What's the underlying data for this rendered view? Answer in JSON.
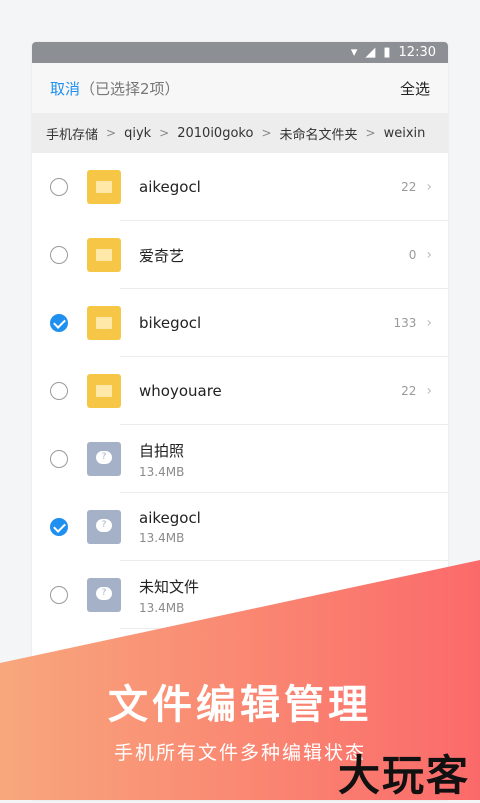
{
  "status": {
    "time": "12:30"
  },
  "toolbar": {
    "cancel": "取消",
    "selection_info": "（已选择2项）",
    "select_all": "全选"
  },
  "breadcrumb": [
    "手机存储",
    "qiyk",
    "2010i0goko",
    "未命名文件夹",
    "weixin"
  ],
  "items": [
    {
      "name": "aikegocl",
      "type": "folder",
      "count": "22",
      "checked": false
    },
    {
      "name": "爱奇艺",
      "type": "folder",
      "count": "0",
      "checked": false
    },
    {
      "name": "bikegocl",
      "type": "folder",
      "count": "133",
      "checked": true
    },
    {
      "name": "whoyouare",
      "type": "folder",
      "count": "22",
      "checked": false
    },
    {
      "name": "自拍照",
      "type": "file",
      "size": "13.4MB",
      "checked": false
    },
    {
      "name": "aikegocl",
      "type": "file",
      "size": "13.4MB",
      "checked": true
    },
    {
      "name": "未知文件",
      "type": "file",
      "size": "13.4MB",
      "checked": false
    }
  ],
  "promo": {
    "title": "文件编辑管理",
    "subtitle": "手机所有文件多种编辑状态"
  },
  "watermark": "大玩客",
  "colors": {
    "accent": "#1f8ff0",
    "banner_from": "#f8a77c",
    "banner_to": "#fb6a6a"
  }
}
